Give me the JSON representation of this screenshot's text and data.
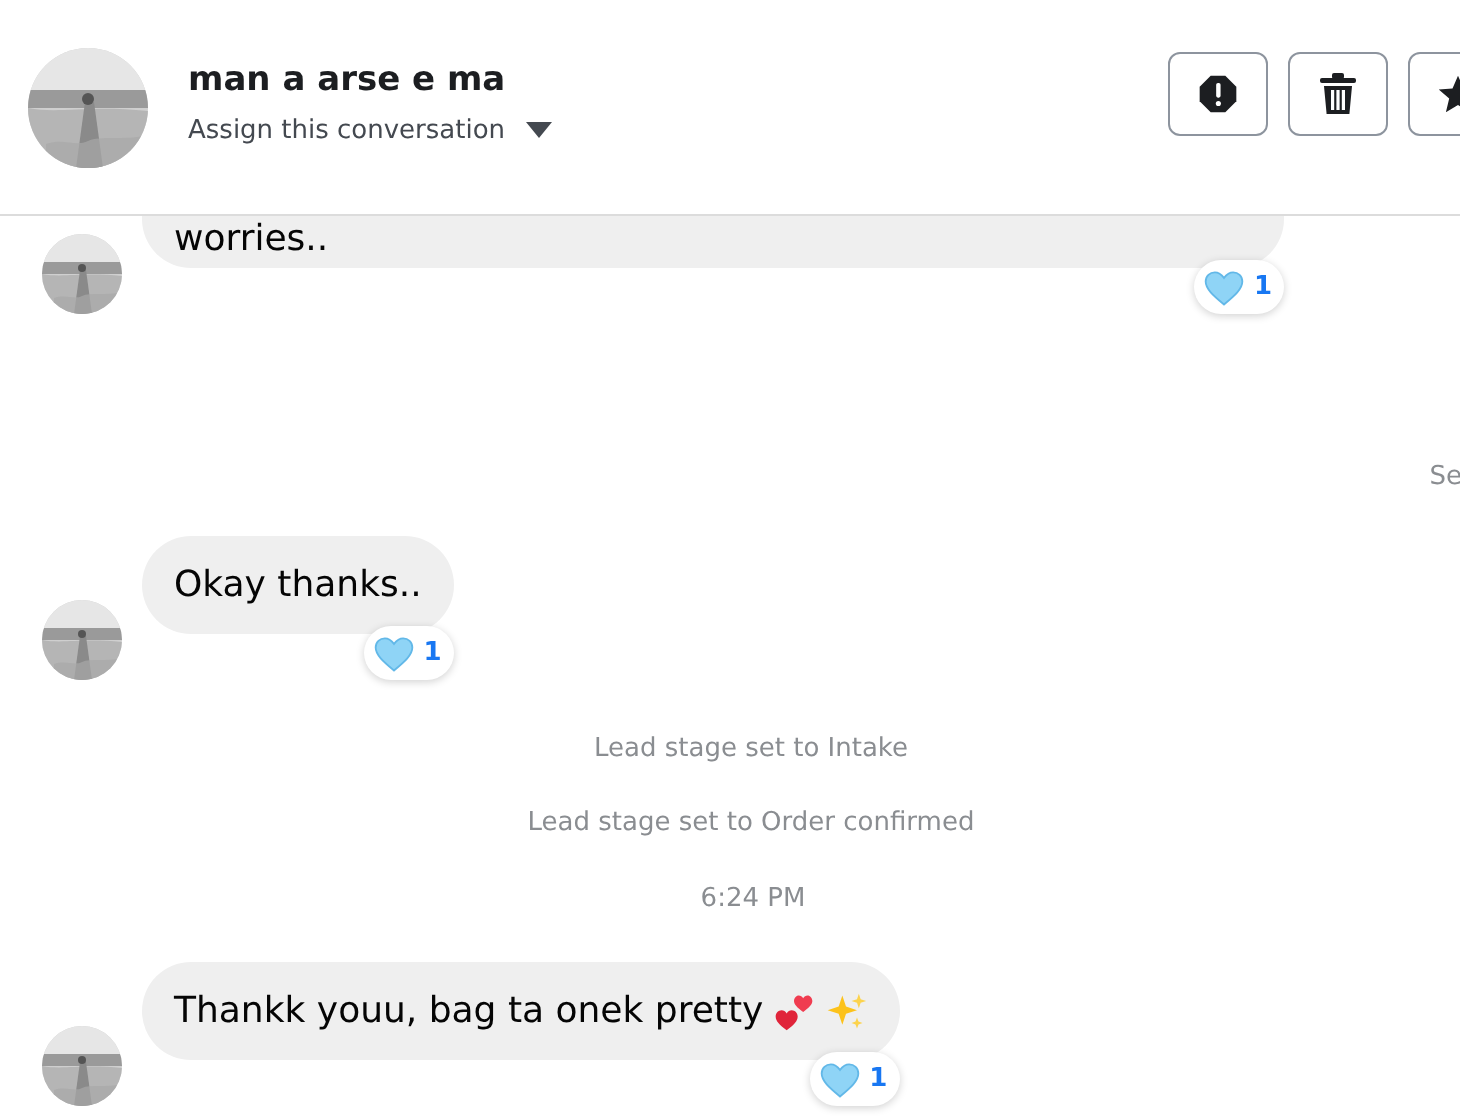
{
  "header": {
    "name": "man a arse e ma",
    "assign": {
      "label": "Assign this conversation"
    },
    "actions": [
      {
        "kind": "report"
      },
      {
        "kind": "delete"
      },
      {
        "kind": "star"
      }
    ]
  },
  "messages": [
    {
      "kind": "incoming",
      "text": "worries..",
      "reaction": {
        "count": "1"
      }
    },
    {
      "kind": "seen",
      "text": "Se"
    },
    {
      "kind": "incoming",
      "text": "Okay thanks..",
      "reaction": {
        "count": "1"
      }
    },
    {
      "kind": "event",
      "text": "Lead stage set to Intake"
    },
    {
      "kind": "event",
      "text": "Lead stage set to Order confirmed"
    },
    {
      "kind": "time",
      "text": "6:24 PM"
    },
    {
      "kind": "incoming",
      "text": "Thankk youu, bag ta onek pretty",
      "reaction": {
        "count": "1"
      },
      "emoji": true
    }
  ]
}
